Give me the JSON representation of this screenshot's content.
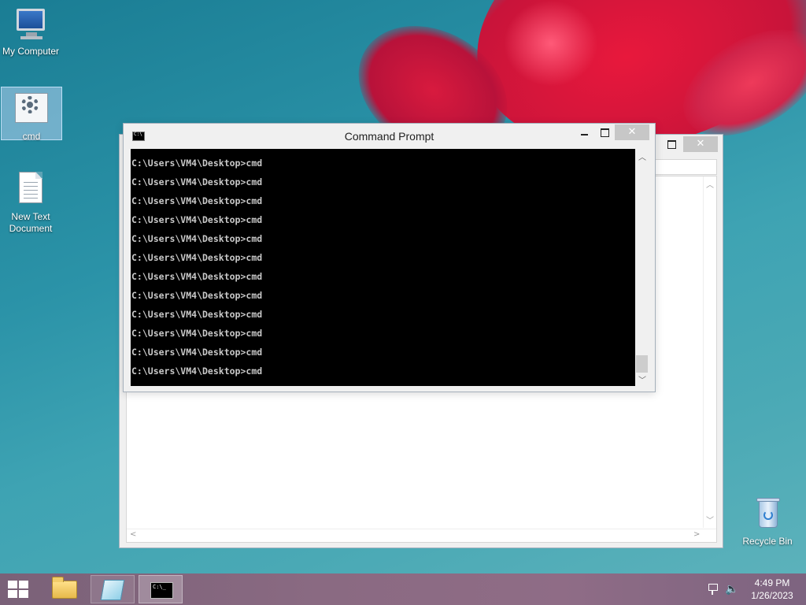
{
  "desktop": {
    "icons": [
      {
        "label": "My Computer"
      },
      {
        "label": "cmd"
      },
      {
        "label": "New Text Document"
      },
      {
        "label": "Recycle Bin"
      }
    ]
  },
  "background_window": {
    "close_glyph": "✕"
  },
  "cmd_window": {
    "title": "Command Prompt",
    "close_glyph": "✕",
    "lines": [
      "C:\\Users\\VM4\\Desktop>cmd",
      "C:\\Users\\VM4\\Desktop>cmd",
      "C:\\Users\\VM4\\Desktop>cmd",
      "C:\\Users\\VM4\\Desktop>cmd",
      "C:\\Users\\VM4\\Desktop>cmd",
      "C:\\Users\\VM4\\Desktop>cmd",
      "C:\\Users\\VM4\\Desktop>cmd",
      "C:\\Users\\VM4\\Desktop>cmd",
      "C:\\Users\\VM4\\Desktop>cmd",
      "C:\\Users\\VM4\\Desktop>cmd",
      "C:\\Users\\VM4\\Desktop>cmd",
      "C:\\Users\\VM4\\Desktop>cmd"
    ]
  },
  "taskbar": {
    "apps": [
      "file-explorer-icon",
      "notebook-icon",
      "command-prompt-icon"
    ],
    "active_app": "command-prompt-icon"
  },
  "tray": {
    "time": "4:49 PM",
    "date": "1/26/2023"
  },
  "colors": {
    "taskbar": "#8a6a82",
    "console_bg": "#000000",
    "console_text": "#c8c8c8",
    "desktop": "#2b93a8"
  }
}
